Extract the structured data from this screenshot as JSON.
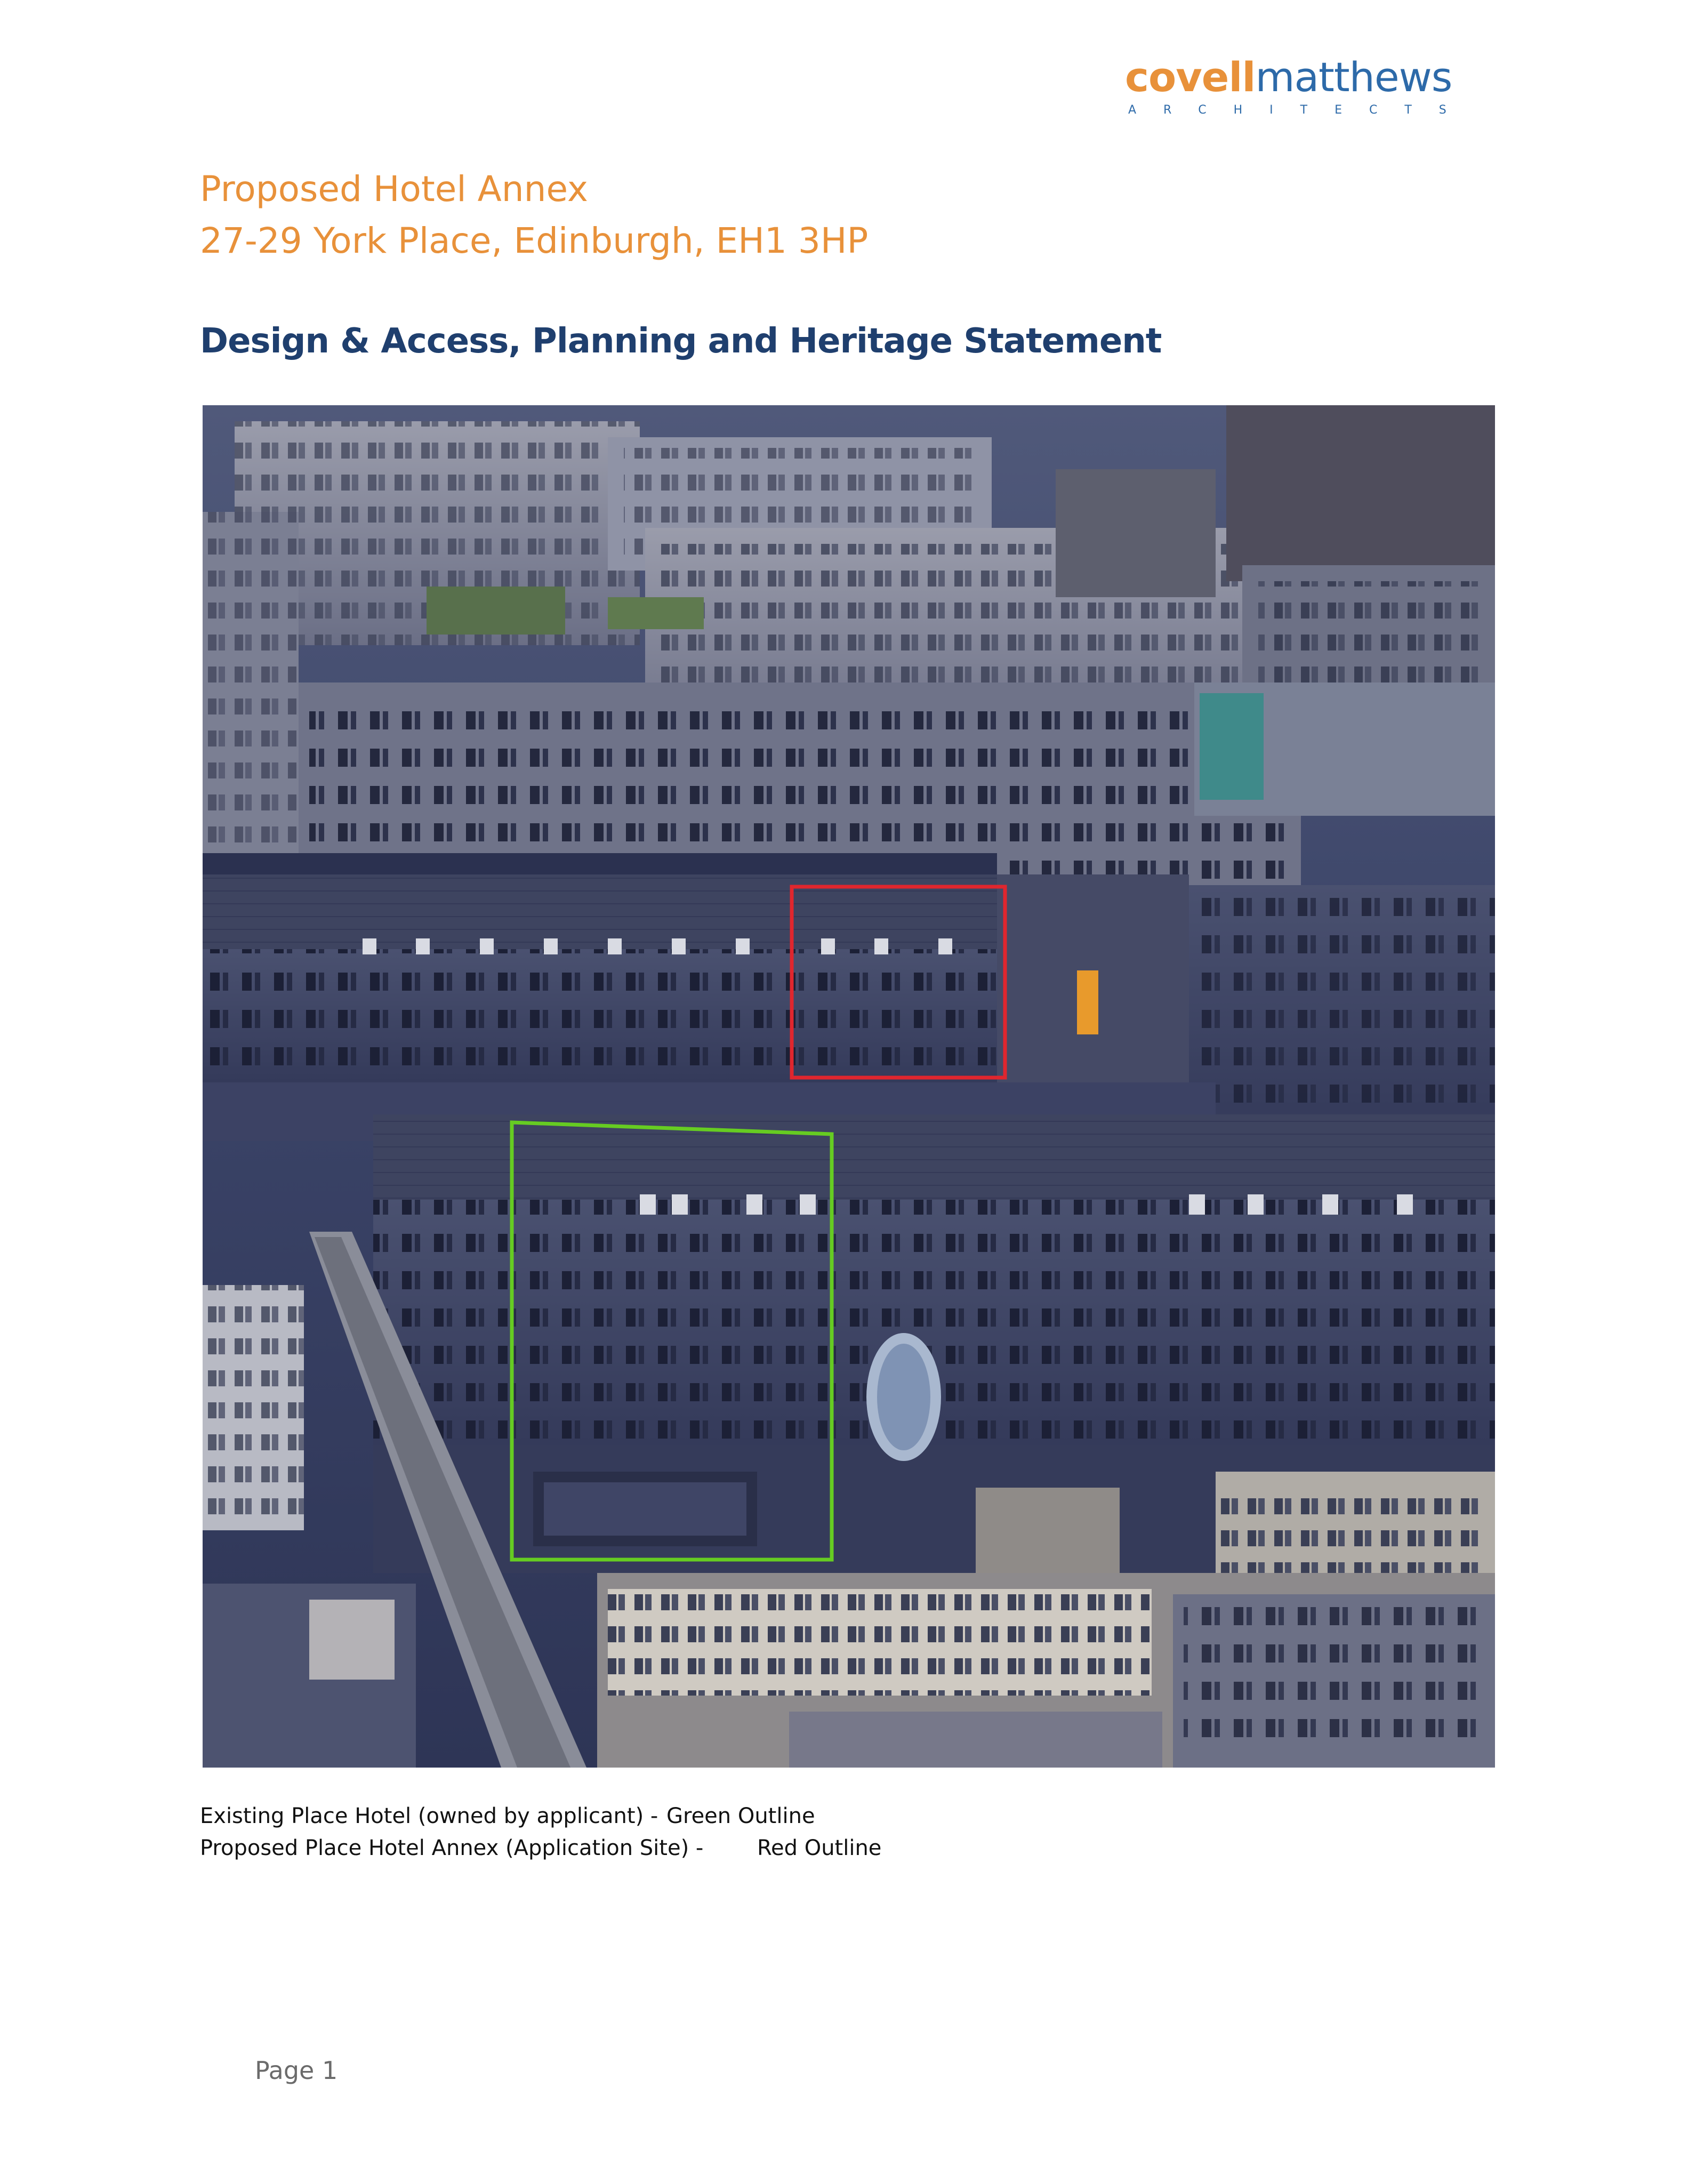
{
  "logo": {
    "brand_part1": "covell",
    "brand_part2": "matthews",
    "tagline": "ARCHITECTS",
    "brand_colors": {
      "covell": "#e8913a",
      "matthews": "#2d6aa9"
    }
  },
  "title": {
    "line1": "Proposed Hotel Annex",
    "line2": "27-29 York Place, Edinburgh, EH1 3HP",
    "color": "#e8913a"
  },
  "heading": {
    "text": "Design & Access, Planning and Heritage Statement",
    "color": "#1f3f6e"
  },
  "figure": {
    "outline_colors": {
      "existing": "#66cc22",
      "proposed": "#e0262e"
    }
  },
  "captions": [
    {
      "label": "Existing Place Hotel (owned by applicant) -",
      "outline": "Green Outline"
    },
    {
      "label": "Proposed Place Hotel Annex (Application Site) -",
      "outline": "Red Outline"
    }
  ],
  "footer": {
    "page": "Page 1"
  }
}
